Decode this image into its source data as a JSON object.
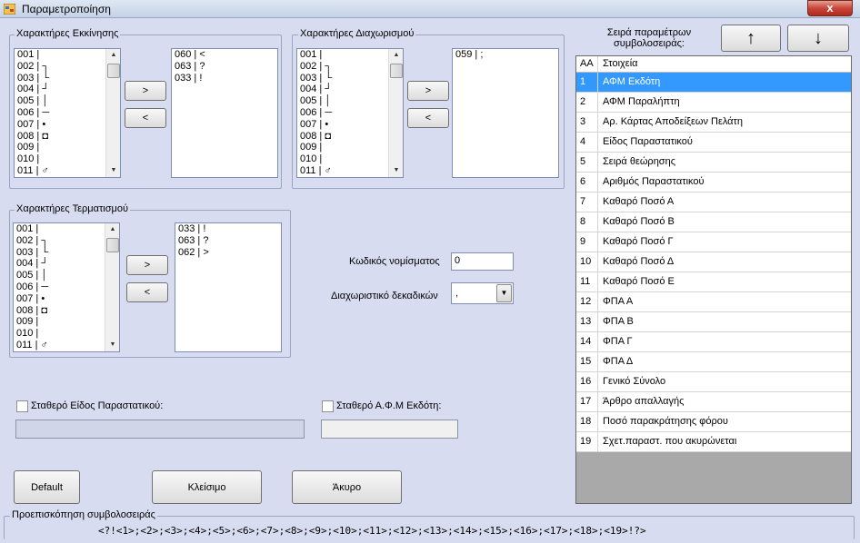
{
  "window": {
    "title": "Παραμετροποίηση",
    "close_glyph": "x",
    "icon": "app-form-icon"
  },
  "start_chars": {
    "legend": "Χαρακτήρες Εκκίνησης",
    "available": [
      "001 |",
      "002 | ┐",
      "003 | └",
      "004 | ┘",
      "005 | │",
      "006 | ─",
      "007 | •",
      "008 | ◘",
      "009 |",
      "010 |",
      "011 | ♂"
    ],
    "selected": [
      "060 | <",
      "063 | ?",
      "033 | !"
    ],
    "add_label": ">",
    "remove_label": "<"
  },
  "separator_chars": {
    "legend": "Χαρακτήρες Διαχωρισμού",
    "available": [
      "001 |",
      "002 | ┐",
      "003 | └",
      "004 | ┘",
      "005 | │",
      "006 | ─",
      "007 | •",
      "008 | ◘",
      "009 |",
      "010 |",
      "011 | ♂"
    ],
    "selected": [
      "059 | ;"
    ],
    "add_label": ">",
    "remove_label": "<"
  },
  "end_chars": {
    "legend": "Χαρακτήρες Τερματισμού",
    "available": [
      "001 |",
      "002 | ┐",
      "003 | └",
      "004 | ┘",
      "005 | │",
      "006 | ─",
      "007 | •",
      "008 | ◘",
      "009 |",
      "010 |",
      "011 | ♂"
    ],
    "selected": [
      "033 | !",
      "063 | ?",
      "062 | >"
    ],
    "add_label": ">",
    "remove_label": "<"
  },
  "currency": {
    "label": "Κωδικός νομίσματος",
    "value": "0"
  },
  "decimal_sep": {
    "label": "Διαχωριστικό δεκαδικών",
    "value": ","
  },
  "fixed_doc_type": {
    "label": "Σταθερό Είδος Παραστατικού:",
    "value": ""
  },
  "fixed_vat": {
    "label": "Σταθερό Α.Φ.Μ Εκδότη:",
    "value": ""
  },
  "buttons": {
    "default": "Default",
    "close": "Κλείσιμο",
    "cancel": "Άκυρο"
  },
  "order": {
    "label_line1": "Σειρά παραμέτρων",
    "label_line2": "συμβολοσειράς:",
    "up": "↑",
    "down": "↓"
  },
  "grid": {
    "col_aa": "ΑΑ",
    "col_items": "Στοιχεία",
    "selected_index": 0,
    "rows": [
      {
        "aa": "1",
        "name": "ΑΦΜ Εκδότη"
      },
      {
        "aa": "2",
        "name": "ΑΦΜ Παραλήπτη"
      },
      {
        "aa": "3",
        "name": "Αρ. Κάρτας Αποδείξεων Πελάτη"
      },
      {
        "aa": "4",
        "name": "Είδος Παραστατικού"
      },
      {
        "aa": "5",
        "name": "Σειρά θεώρησης"
      },
      {
        "aa": "6",
        "name": "Αριθμός Παραστατικού"
      },
      {
        "aa": "7",
        "name": "Καθαρό Ποσό Α"
      },
      {
        "aa": "8",
        "name": "Καθαρό Ποσό Β"
      },
      {
        "aa": "9",
        "name": "Καθαρό Ποσό Γ"
      },
      {
        "aa": "10",
        "name": "Καθαρό Ποσό Δ"
      },
      {
        "aa": "11",
        "name": "Καθαρό Ποσό Ε"
      },
      {
        "aa": "12",
        "name": "ΦΠΑ Α"
      },
      {
        "aa": "13",
        "name": "ΦΠΑ Β"
      },
      {
        "aa": "14",
        "name": "ΦΠΑ Γ"
      },
      {
        "aa": "15",
        "name": "ΦΠΑ Δ"
      },
      {
        "aa": "16",
        "name": "Γενικό Σύνολο"
      },
      {
        "aa": "17",
        "name": "Άρθρο απαλλαγής"
      },
      {
        "aa": "18",
        "name": "Ποσό παρακράτησης φόρου"
      },
      {
        "aa": "19",
        "name": "Σχετ.παραστ. που ακυρώνεται"
      }
    ]
  },
  "preview": {
    "legend": "Προεπισκόπηση συμβολοσειράς",
    "text": "<?!<1>;<2>;<3>;<4>;<5>;<6>;<7>;<8>;<9>;<10>;<11>;<12>;<13>;<14>;<15>;<16>;<17>;<18>;<19>!?>"
  }
}
